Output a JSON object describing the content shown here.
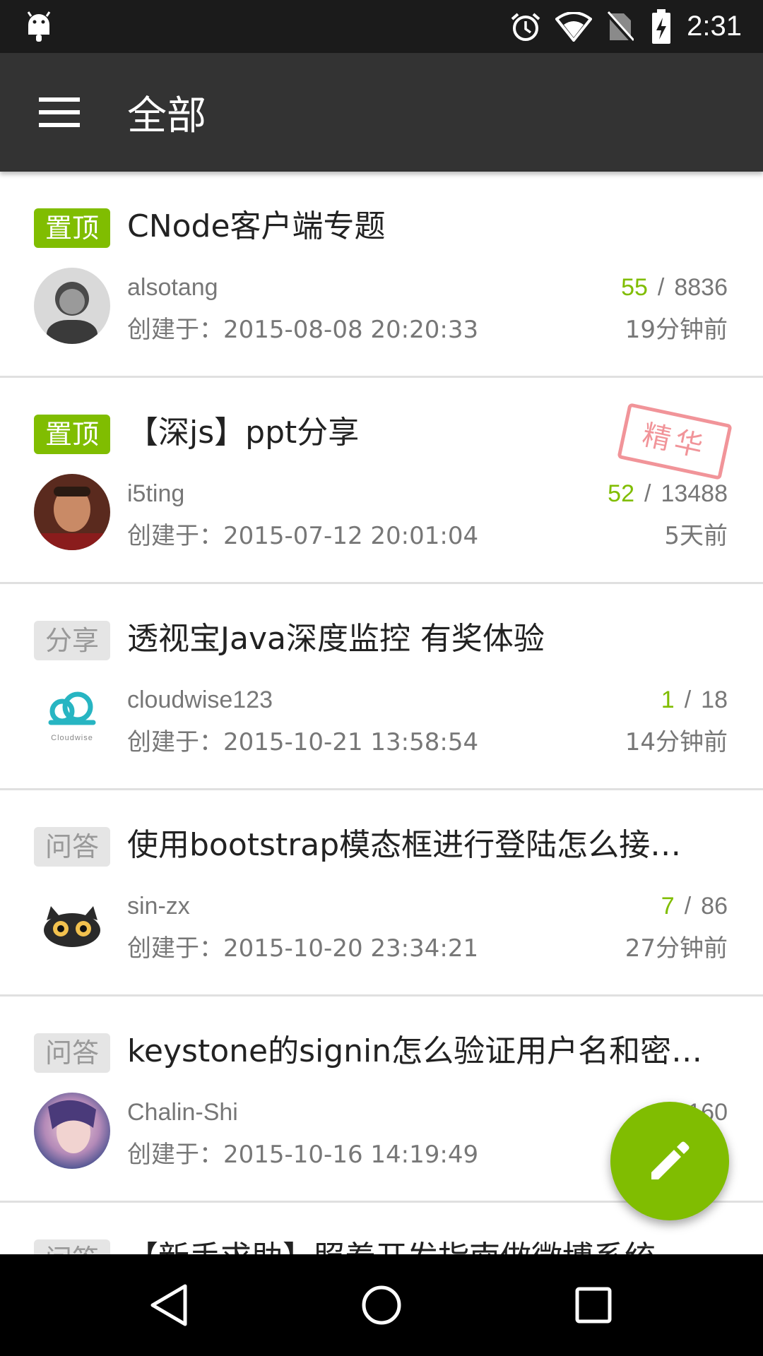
{
  "status_bar": {
    "time": "2:31",
    "icons": [
      "android-icon",
      "alarm-icon",
      "wifi-icon",
      "no-sim-icon",
      "battery-charging-icon"
    ]
  },
  "app_bar": {
    "title": "全部",
    "menu_icon": "menu-icon"
  },
  "colors": {
    "accent": "#80bd01",
    "app_bar": "#333333",
    "status_bar": "#1b1b1b",
    "badge_gray": "#e5e5e5",
    "stamp_red": "#e63c46"
  },
  "topics": [
    {
      "tab": "置顶",
      "tab_style": "top",
      "title": "CNode客户端专题",
      "author": "alsotang",
      "create_time": "创建于：2015-08-08 20:20:33",
      "reply_count": "55",
      "visit_count": "8836",
      "last_reply": "19分钟前",
      "good": false
    },
    {
      "tab": "置顶",
      "tab_style": "top",
      "title": "【深js】ppt分享",
      "author": "i5ting",
      "create_time": "创建于：2015-07-12 20:01:04",
      "reply_count": "52",
      "visit_count": "13488",
      "last_reply": "5天前",
      "good": true,
      "good_label": "精华"
    },
    {
      "tab": "分享",
      "tab_style": "normal",
      "title": "透视宝Java深度监控 有奖体验",
      "author": "cloudwise123",
      "create_time": "创建于：2015-10-21 13:58:54",
      "reply_count": "1",
      "visit_count": "18",
      "last_reply": "14分钟前",
      "good": false,
      "avatar_text": "Cloudwise"
    },
    {
      "tab": "问答",
      "tab_style": "normal",
      "title": "使用bootstrap模态框进行登陆怎么接…",
      "author": "sin-zx",
      "create_time": "创建于：2015-10-20 23:34:21",
      "reply_count": "7",
      "visit_count": "86",
      "last_reply": "27分钟前",
      "good": false
    },
    {
      "tab": "问答",
      "tab_style": "normal",
      "title": "keystone的signin怎么验证用户名和密…",
      "author": "Chalin-Shi",
      "create_time": "创建于：2015-10-16 14:19:49",
      "reply_count": "",
      "visit_count": "160",
      "last_reply": "",
      "good": false
    },
    {
      "tab": "问答",
      "tab_style": "normal",
      "title": "【新手求助】照着开发指南做微博系统",
      "author": "",
      "create_time": "",
      "reply_count": "",
      "visit_count": "",
      "last_reply": "",
      "good": false
    }
  ],
  "fab": {
    "icon": "pencil-icon"
  },
  "nav_bar": {
    "buttons": [
      "back-icon",
      "home-icon",
      "recents-icon"
    ]
  }
}
